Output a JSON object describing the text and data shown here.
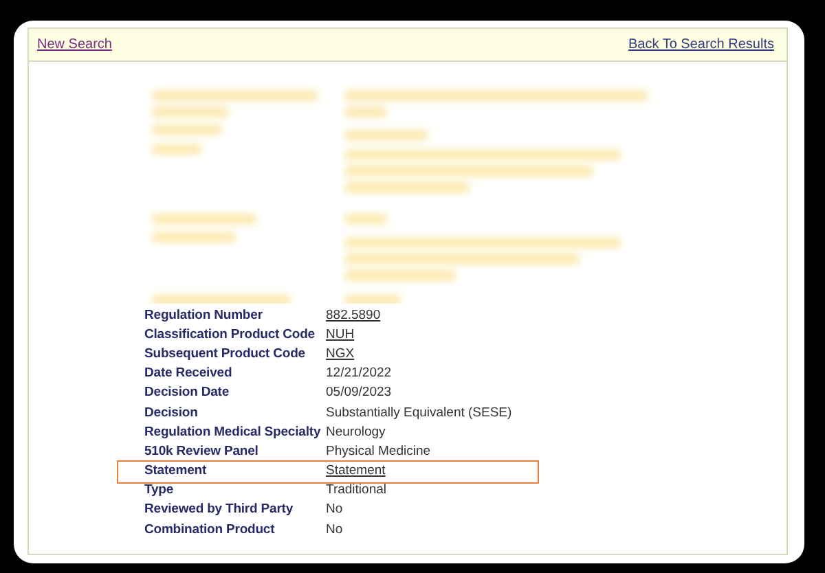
{
  "header": {
    "links": [
      {
        "label": "New Search",
        "visited": true
      },
      {
        "label": "Back To Search Results",
        "visited": false
      }
    ]
  },
  "details": {
    "blurred": true,
    "rows": [
      {
        "label": "Regulation Number",
        "value": "882.5890",
        "kind": "link",
        "highlighted": false
      },
      {
        "label": "Classification Product Code",
        "value": "NUH",
        "kind": "link",
        "highlighted": false
      },
      {
        "label": "Subsequent Product Code",
        "value": "NGX",
        "kind": "link",
        "highlighted": false
      },
      {
        "label": "Date Received",
        "value": "12/21/2022",
        "kind": "text",
        "highlighted": false
      },
      {
        "label": "Decision Date",
        "value": "05/09/2023",
        "kind": "text",
        "highlighted": false
      },
      {
        "label": "Decision",
        "value": "Substantially Equivalent (SESE)",
        "kind": "text",
        "highlighted": false
      },
      {
        "label": "Regulation Medical Specialty",
        "value": "Neurology",
        "kind": "text",
        "highlighted": false
      },
      {
        "label": "510k Review Panel",
        "value": "Physical Medicine",
        "kind": "text",
        "highlighted": false
      },
      {
        "label": "Statement",
        "value": "Statement",
        "kind": "link",
        "highlighted": true
      },
      {
        "label": "Type",
        "value": "Traditional",
        "kind": "text",
        "highlighted": false
      },
      {
        "label": "Reviewed by Third Party",
        "value": "No",
        "kind": "text",
        "highlighted": false
      },
      {
        "label": "Combination Product",
        "value": "No",
        "kind": "text",
        "highlighted": false
      }
    ]
  }
}
